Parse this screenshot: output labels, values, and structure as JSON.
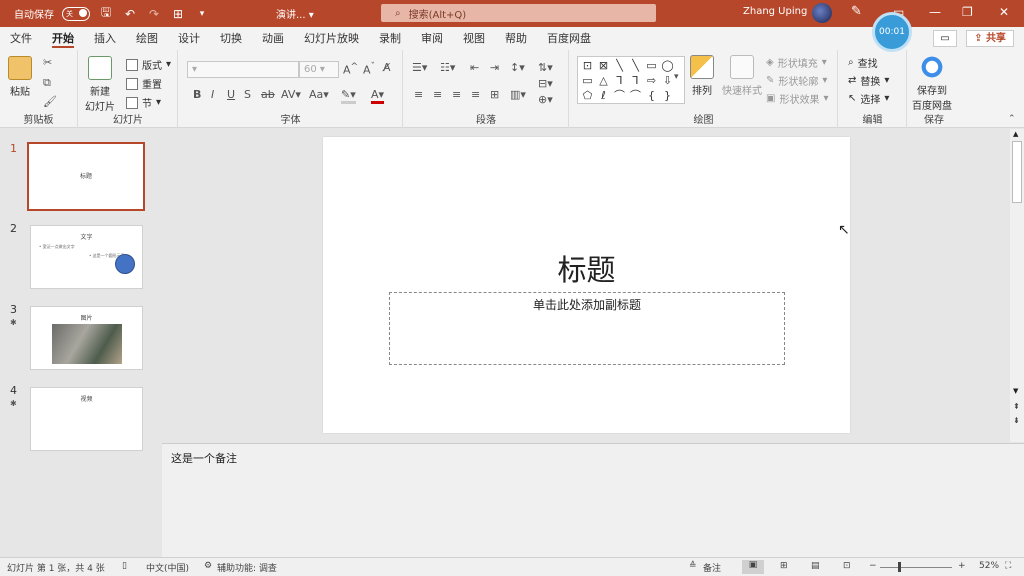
{
  "titlebar": {
    "autosave_label": "自动保存",
    "autosave_state": "关",
    "doc_title": "演讲...",
    "search_placeholder": "搜索(Alt+Q)",
    "user_name": "Zhang Uping",
    "timer": "00:01"
  },
  "tabs": [
    "文件",
    "开始",
    "插入",
    "绘图",
    "设计",
    "切换",
    "动画",
    "幻灯片放映",
    "录制",
    "审阅",
    "视图",
    "帮助",
    "百度网盘"
  ],
  "active_tab": "开始",
  "share_label": "共享",
  "ribbon": {
    "clipboard": {
      "paste": "粘贴",
      "label": "剪贴板"
    },
    "slides": {
      "new_slide": "新建",
      "new_slide2": "幻灯片",
      "layout": "版式",
      "reset": "重置",
      "section": "节",
      "label": "幻灯片"
    },
    "font": {
      "font_size": "60",
      "label": "字体"
    },
    "paragraph": {
      "label": "段落"
    },
    "drawing": {
      "arrange": "排列",
      "quick_styles": "快速样式",
      "shape_fill": "形状填充",
      "shape_outline": "形状轮廓",
      "shape_effects": "形状效果",
      "label": "绘图"
    },
    "editing": {
      "find": "查找",
      "replace": "替换",
      "select": "选择",
      "label": "编辑"
    },
    "save": {
      "line1": "保存到",
      "line2": "百度网盘",
      "label": "保存"
    }
  },
  "thumbnails": [
    {
      "num": "1",
      "title": "标题"
    },
    {
      "num": "2",
      "title": "文字",
      "line1": "• 宽泛一点做出文字",
      "line2": "• 这是一个圆形示意"
    },
    {
      "num": "3",
      "title": "图片"
    },
    {
      "num": "4",
      "title": "视频"
    }
  ],
  "slide": {
    "title": "标题",
    "subtitle_placeholder": "单击此处添加副标题"
  },
  "notes": "这是一个备注",
  "status": {
    "slide_info": "幻灯片 第 1 张，共 4 张",
    "language": "中文(中国)",
    "accessibility": "辅助功能: 调查",
    "notes_btn": "备注",
    "zoom": "52%"
  }
}
